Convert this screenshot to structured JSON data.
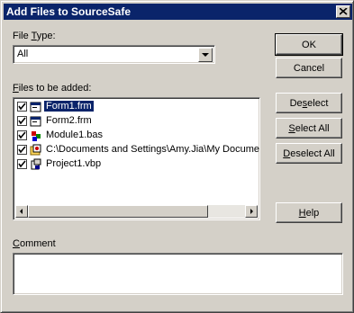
{
  "dialog": {
    "title": "Add Files to SourceSafe"
  },
  "file_type": {
    "label_prefix": "File ",
    "label_key": "T",
    "label_suffix": "ype:",
    "value": "All"
  },
  "files": {
    "label_key": "F",
    "label_suffix": "iles to be added:",
    "items": [
      {
        "name": "Form1.frm",
        "checked": true,
        "icon": "form-file-icon",
        "selected": true
      },
      {
        "name": "Form2.frm",
        "checked": true,
        "icon": "form-file-icon",
        "selected": false
      },
      {
        "name": "Module1.bas",
        "checked": true,
        "icon": "module-file-icon",
        "selected": false
      },
      {
        "name": "C:\\Documents and Settings\\Amy.Jia\\My Documer",
        "checked": true,
        "icon": "project-group-icon",
        "selected": false
      },
      {
        "name": "Project1.vbp",
        "checked": true,
        "icon": "project-file-icon",
        "selected": false
      }
    ]
  },
  "buttons": {
    "ok": "OK",
    "cancel": "Cancel",
    "deselect_a": "De",
    "deselect_k": "s",
    "deselect_b": "elect",
    "selectall_k": "S",
    "selectall_b": "elect All",
    "deselectall_k": "D",
    "deselectall_b": "eselect All",
    "help_k": "H",
    "help_b": "elp"
  },
  "comment": {
    "label_key": "C",
    "label_suffix": "omment",
    "value": ""
  }
}
